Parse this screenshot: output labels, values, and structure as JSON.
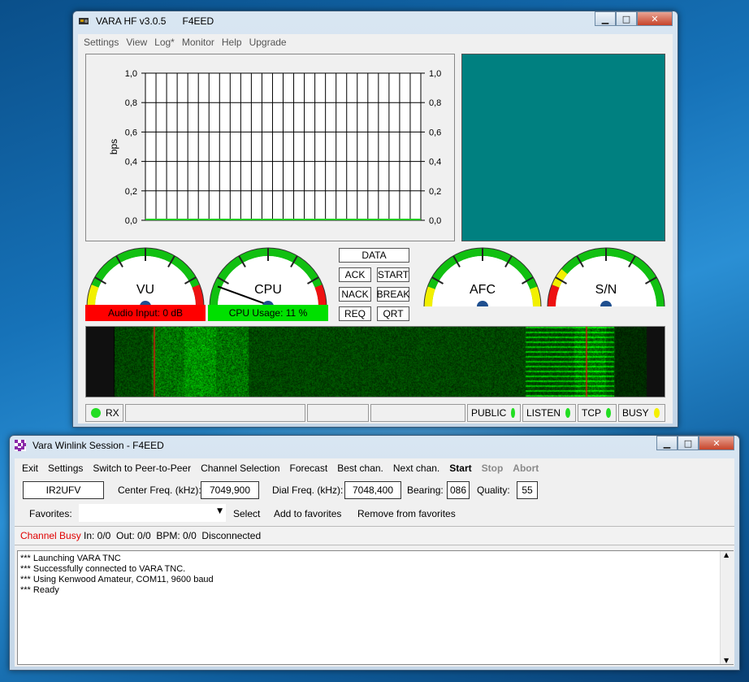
{
  "vara": {
    "title": "VARA HF v3.0.5      F4EED",
    "menu": [
      "Settings",
      "View",
      "Log*",
      "Monitor",
      "Help",
      "Upgrade"
    ],
    "chart_data": {
      "type": "line",
      "ylabel": "bps",
      "yticks": [
        "1,0",
        "0,8",
        "0,6",
        "0,4",
        "0,2",
        "0,0"
      ],
      "ylim": [
        0,
        1
      ],
      "series": [
        {
          "values": [
            0,
            0,
            0,
            0,
            0,
            0,
            0,
            0,
            0,
            0,
            0,
            0,
            0,
            0,
            0,
            0,
            0,
            0,
            0,
            0,
            0,
            0,
            0,
            0,
            0,
            0,
            0
          ]
        }
      ],
      "grid": true,
      "line_color": "#22cc22"
    },
    "gauges": {
      "vu": {
        "label": "VU",
        "caption": "Audio Input: 0 dB",
        "caption_color": "#ff0000"
      },
      "cpu": {
        "label": "CPU",
        "caption": "CPU Usage: 11 %",
        "caption_color": "#00e000"
      },
      "afc": {
        "label": "AFC"
      },
      "sn": {
        "label": "S/N"
      }
    },
    "buttons": {
      "data": "DATA",
      "ack": "ACK",
      "start": "START",
      "nack": "NACK",
      "break": "BREAK",
      "req": "REQ",
      "qrt": "QRT"
    },
    "status": {
      "rx": "RX",
      "public": "PUBLIC",
      "listen": "LISTEN",
      "tcp": "TCP",
      "busy": "BUSY"
    }
  },
  "winlink": {
    "title": "Vara Winlink Session - F4EED",
    "menu": [
      "Exit",
      "Settings",
      "Switch to Peer-to-Peer",
      "Channel Selection",
      "Forecast",
      "Best chan.",
      "Next chan.",
      "Start",
      "Stop",
      "Abort"
    ],
    "callsign": "IR2UFV",
    "center_label": "Center Freq. (kHz):",
    "center_value": "7049,900",
    "dial_label": "Dial Freq. (kHz):",
    "dial_value": "7048,400",
    "bearing_label": "Bearing:",
    "bearing_value": "086",
    "quality_label": "Quality:",
    "quality_value": "55",
    "favorites_label": "Favorites:",
    "favorites_value": "",
    "select": "Select",
    "add_fav": "Add to favorites",
    "remove_fav": "Remove from favorites",
    "status_busy": "Channel Busy",
    "status_rest": "In: 0/0  Out: 0/0  BPM: 0/0  Disconnected",
    "log": [
      "*** Launching VARA TNC",
      "*** Successfully connected to VARA TNC.",
      "*** Using Kenwood Amateur, COM11, 9600 baud",
      "*** Ready"
    ]
  }
}
